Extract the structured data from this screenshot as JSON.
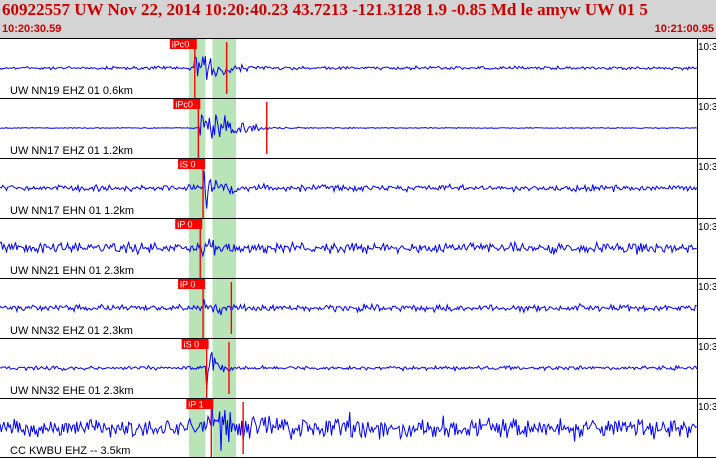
{
  "header": {
    "title": "60922557 UW Nov 22, 2014 10:20:40.23    43.7213 -121.3128  1.9 -0.85 Md le amyw UW 01    5",
    "time_start": "10:20:30.59",
    "time_end": "10:21:00.95"
  },
  "colors": {
    "trace": "#0000ff",
    "pick": "#ff0000",
    "window": "#b8e4b8",
    "header_bg": "#d4d4d4",
    "header_text": "#cc0000"
  },
  "time_window": {
    "start_s": 30.59,
    "end_s": 60.95
  },
  "traces": [
    {
      "label": "UW NN19 EHZ 01 0.6km",
      "pick_label": "iPc0",
      "right_label": "10:3",
      "pick_time_s": 38.85,
      "amplitude": 0.9,
      "noise": 0.05,
      "decay": 0.22,
      "coda": 0.0,
      "extra_pick_s": 40.2
    },
    {
      "label": "UW NN17 EHZ 01 1.2km",
      "pick_label": "iPc0",
      "right_label": "10:3",
      "pick_time_s": 39.0,
      "amplitude": 1.0,
      "noise": 0.015,
      "decay": 0.28,
      "coda": 0.0,
      "extra_pick_s": 41.9
    },
    {
      "label": "UW NN17 EHN 01 1.2km",
      "pick_label": "iS 0",
      "right_label": "10:3",
      "pick_time_s": 39.2,
      "amplitude": 0.7,
      "noise": 0.09,
      "decay": 0.2,
      "coda": 0.04,
      "extra_pick_s": null
    },
    {
      "label": "UW NN21 EHN 01 2.3km",
      "pick_label": "iP 0",
      "right_label": "10:3",
      "pick_time_s": 39.08,
      "amplitude": 0.75,
      "noise": 0.16,
      "decay": 0.1,
      "coda": 0.08,
      "extra_pick_s": null
    },
    {
      "label": "UW NN32 EHZ 01 2.3km",
      "pick_label": "iP 0",
      "right_label": "10:3",
      "pick_time_s": 39.2,
      "amplitude": 0.6,
      "noise": 0.1,
      "decay": 0.15,
      "coda": 0.05,
      "extra_pick_s": 40.4
    },
    {
      "label": "UW NN32 EHE 01 2.3km",
      "pick_label": "iS 0",
      "right_label": "10:3",
      "pick_time_s": 39.35,
      "amplitude": 0.7,
      "noise": 0.06,
      "decay": 0.12,
      "coda": 0.0,
      "extra_pick_s": 40.3
    },
    {
      "label": "CC KWBU EHZ -- 3.5km",
      "pick_label": "iP 1",
      "right_label": "10:3",
      "pick_time_s": 39.55,
      "amplitude": 0.9,
      "noise": 0.28,
      "decay": 0.08,
      "coda": 0.35,
      "extra_pick_s": 40.9
    }
  ],
  "window_bands": [
    {
      "start_s": 38.6,
      "end_s": 39.3
    },
    {
      "start_s": 39.6,
      "end_s": 40.6
    }
  ]
}
